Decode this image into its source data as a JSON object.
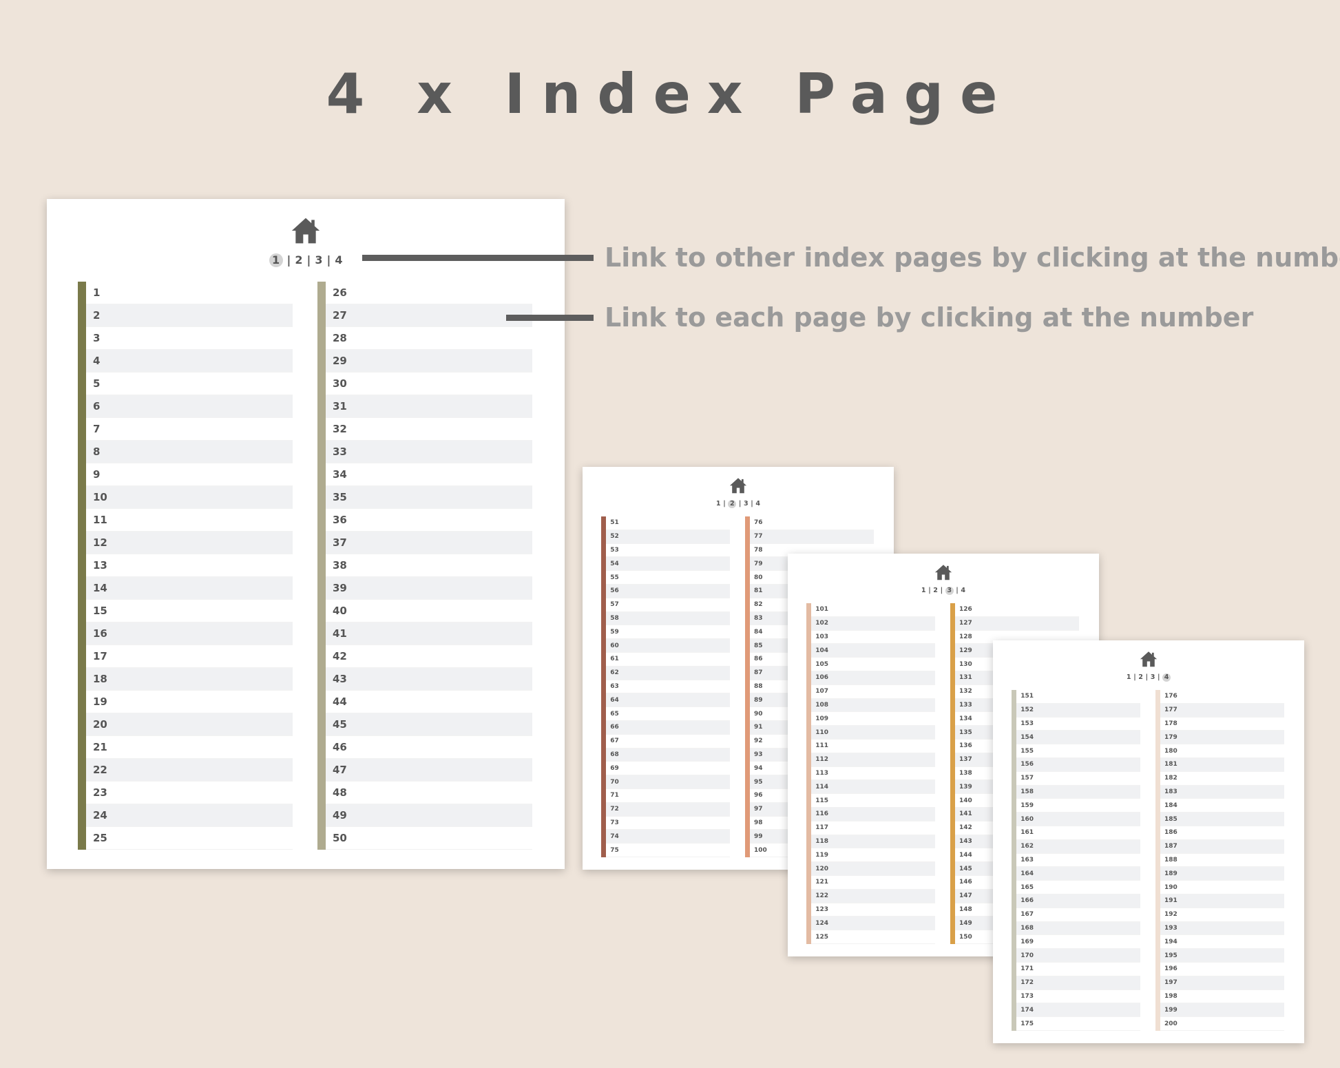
{
  "title": "4 x Index Page",
  "annotations": {
    "nav_hint": "Link to other index pages by clicking at the number",
    "page_hint": "Link to each page by clicking at the number"
  },
  "nav_separator": "|",
  "index_pages": [
    {
      "current": "1",
      "nav_items": [
        "1",
        "2",
        "3",
        "4"
      ],
      "left_bar_color": "#7A7A4A",
      "right_bar_color": "#AFAB8F",
      "left_numbers": [
        "1",
        "2",
        "3",
        "4",
        "5",
        "6",
        "7",
        "8",
        "9",
        "10",
        "11",
        "12",
        "13",
        "14",
        "15",
        "16",
        "17",
        "18",
        "19",
        "20",
        "21",
        "22",
        "23",
        "24",
        "25"
      ],
      "right_numbers": [
        "26",
        "27",
        "28",
        "29",
        "30",
        "31",
        "32",
        "33",
        "34",
        "35",
        "36",
        "37",
        "38",
        "39",
        "40",
        "41",
        "42",
        "43",
        "44",
        "45",
        "46",
        "47",
        "48",
        "49",
        "50"
      ]
    },
    {
      "current": "2",
      "nav_items": [
        "1",
        "2",
        "3",
        "4"
      ],
      "left_bar_color": "#A05E4C",
      "right_bar_color": "#E09A78",
      "left_numbers": [
        "51",
        "52",
        "53",
        "54",
        "55",
        "56",
        "57",
        "58",
        "59",
        "60",
        "61",
        "62",
        "63",
        "64",
        "65",
        "66",
        "67",
        "68",
        "69",
        "70",
        "71",
        "72",
        "73",
        "74",
        "75"
      ],
      "right_numbers": [
        "76",
        "77",
        "78",
        "79",
        "80",
        "81",
        "82",
        "83",
        "84",
        "85",
        "86",
        "87",
        "88",
        "89",
        "90",
        "91",
        "92",
        "93",
        "94",
        "95",
        "96",
        "97",
        "98",
        "99",
        "100"
      ]
    },
    {
      "current": "3",
      "nav_items": [
        "1",
        "2",
        "3",
        "4"
      ],
      "left_bar_color": "#E3BBA3",
      "right_bar_color": "#D9A048",
      "left_numbers": [
        "101",
        "102",
        "103",
        "104",
        "105",
        "106",
        "107",
        "108",
        "109",
        "110",
        "111",
        "112",
        "113",
        "114",
        "115",
        "116",
        "117",
        "118",
        "119",
        "120",
        "121",
        "122",
        "123",
        "124",
        "125"
      ],
      "right_numbers": [
        "126",
        "127",
        "128",
        "129",
        "130",
        "131",
        "132",
        "133",
        "134",
        "135",
        "136",
        "137",
        "138",
        "139",
        "140",
        "141",
        "142",
        "143",
        "144",
        "145",
        "146",
        "147",
        "148",
        "149",
        "150"
      ]
    },
    {
      "current": "4",
      "nav_items": [
        "1",
        "2",
        "3",
        "4"
      ],
      "left_bar_color": "#C9C8B8",
      "right_bar_color": "#F0DFD2",
      "left_numbers": [
        "151",
        "152",
        "153",
        "154",
        "155",
        "156",
        "157",
        "158",
        "159",
        "160",
        "161",
        "162",
        "163",
        "164",
        "165",
        "166",
        "167",
        "168",
        "169",
        "170",
        "171",
        "172",
        "173",
        "174",
        "175"
      ],
      "right_numbers": [
        "176",
        "177",
        "178",
        "179",
        "180",
        "181",
        "182",
        "183",
        "184",
        "185",
        "186",
        "187",
        "188",
        "189",
        "190",
        "191",
        "192",
        "193",
        "194",
        "195",
        "196",
        "197",
        "198",
        "199",
        "200"
      ]
    }
  ],
  "icons": {
    "home": "home-icon"
  },
  "colors": {
    "background": "#EEE4DA",
    "title": "#5a5a5a",
    "annotation": "#9a9a9a",
    "leader": "#5d5d5d"
  }
}
